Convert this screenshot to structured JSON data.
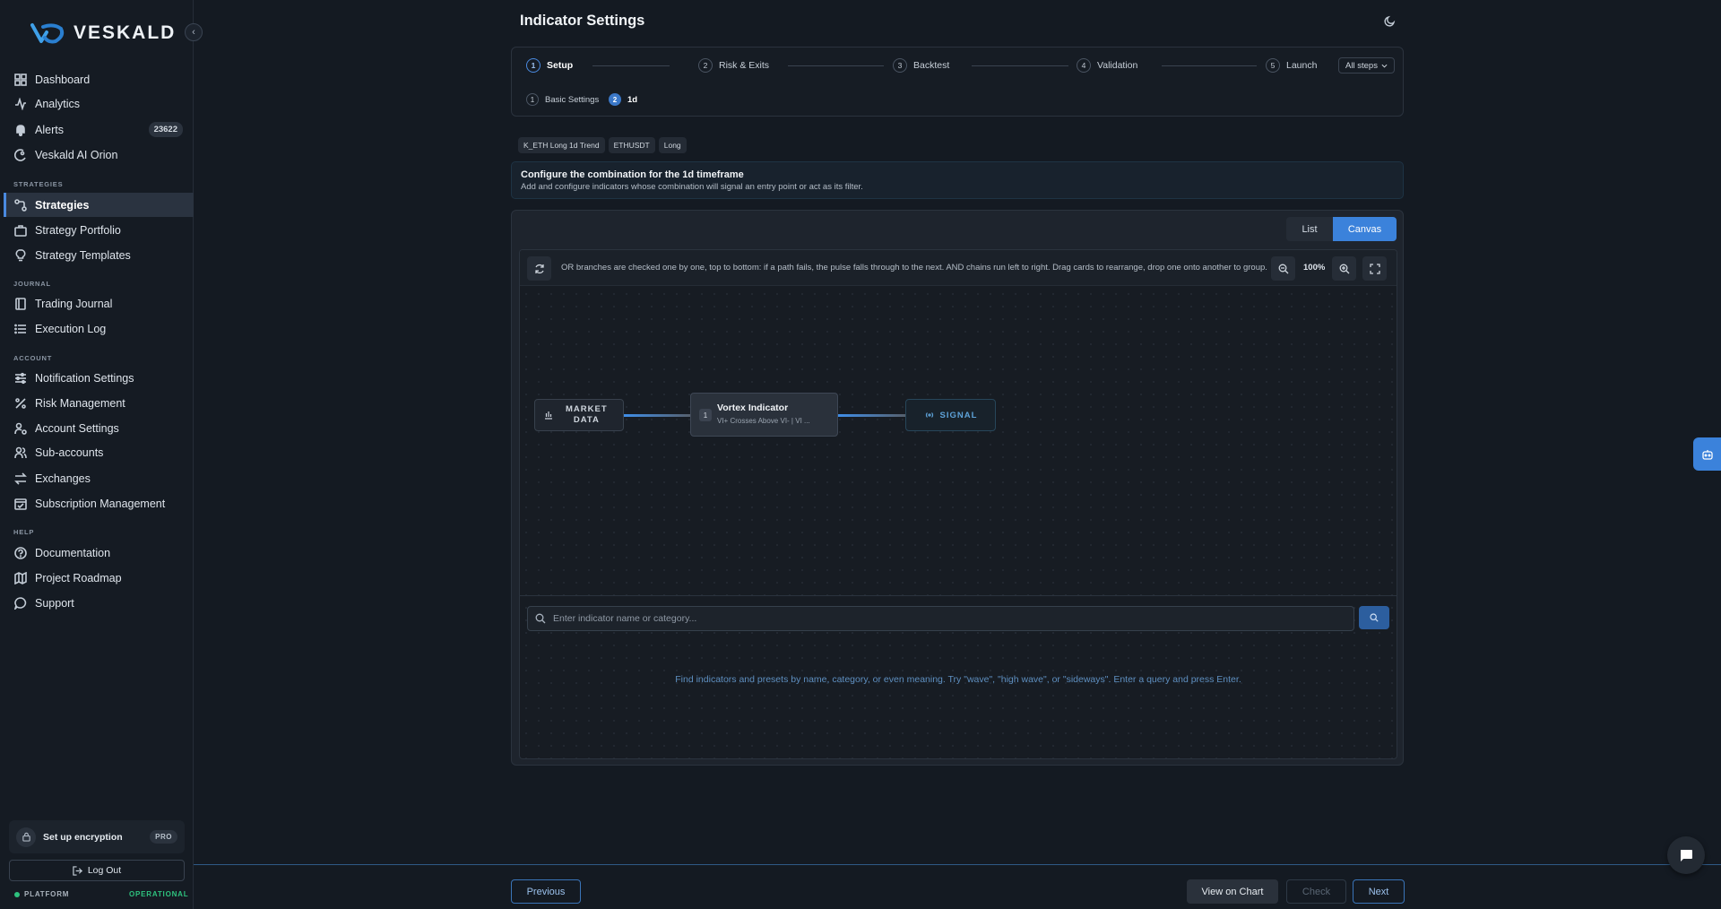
{
  "brand": {
    "name": "VESKALD"
  },
  "sidebar": {
    "items_main": [
      {
        "label": "Dashboard"
      },
      {
        "label": "Analytics"
      },
      {
        "label": "Alerts",
        "badge": "23622"
      },
      {
        "label": "Veskald AI Orion"
      }
    ],
    "sections": {
      "strategies": "STRATEGIES",
      "journal": "JOURNAL",
      "account": "ACCOUNT",
      "help": "HELP"
    },
    "items_strategies": [
      {
        "label": "Strategies",
        "active": true
      },
      {
        "label": "Strategy Portfolio"
      },
      {
        "label": "Strategy Templates"
      }
    ],
    "items_journal": [
      {
        "label": "Trading Journal"
      },
      {
        "label": "Execution Log"
      }
    ],
    "items_account": [
      {
        "label": "Notification Settings"
      },
      {
        "label": "Risk Management"
      },
      {
        "label": "Account Settings"
      },
      {
        "label": "Sub-accounts"
      },
      {
        "label": "Exchanges"
      },
      {
        "label": "Subscription Management"
      }
    ],
    "items_help": [
      {
        "label": "Documentation"
      },
      {
        "label": "Project Roadmap"
      },
      {
        "label": "Support"
      }
    ],
    "encryption": {
      "label": "Set up encryption",
      "tag": "PRO"
    },
    "logout": "Log Out",
    "platform": {
      "label": "PLATFORM",
      "status": "OPERATIONAL",
      "status_color": "#2ec27e"
    }
  },
  "header": {
    "title": "Indicator Settings"
  },
  "stepper": {
    "steps": [
      {
        "num": "1",
        "label": "Setup",
        "active": true
      },
      {
        "num": "2",
        "label": "Risk & Exits"
      },
      {
        "num": "3",
        "label": "Backtest"
      },
      {
        "num": "4",
        "label": "Validation"
      },
      {
        "num": "5",
        "label": "Launch"
      }
    ],
    "all_steps": "All steps",
    "substeps": [
      {
        "num": "1",
        "label": "Basic Settings"
      },
      {
        "num": "2",
        "label": "1d",
        "active": true
      }
    ]
  },
  "tags": [
    "K_ETH Long 1d Trend",
    "ETHUSDT",
    "Long"
  ],
  "info": {
    "title": "Configure the combination for the 1d timeframe",
    "subtitle": "Add and configure indicators whose combination will signal an entry point or act as its filter."
  },
  "view_toggle": {
    "list": "List",
    "canvas": "Canvas",
    "selected": "Canvas"
  },
  "canvas": {
    "hint": "OR branches are checked one by one, top to bottom: if a path fails, the pulse falls through to the next. AND chains run left to right. Drag cards to rearrange, drop one onto another to group.",
    "zoom": "100%",
    "nodes": {
      "market": {
        "line1": "MARKET",
        "line2": "DATA"
      },
      "indicator": {
        "index": "1",
        "title": "Vortex Indicator",
        "subtitle": "VI+ Crosses Above VI- | VI ..."
      },
      "signal": {
        "label": "SIGNAL"
      }
    }
  },
  "search": {
    "placeholder": "Enter indicator name or category...",
    "hint": "Find indicators and presets by name, category, or even meaning. Try \"wave\", \"high wave\", or \"sideways\". Enter a query and press Enter."
  },
  "footer": {
    "previous": "Previous",
    "view_chart": "View on Chart",
    "check": "Check",
    "next": "Next"
  },
  "colors": {
    "accent": "#3b82db",
    "background": "#141a22"
  }
}
